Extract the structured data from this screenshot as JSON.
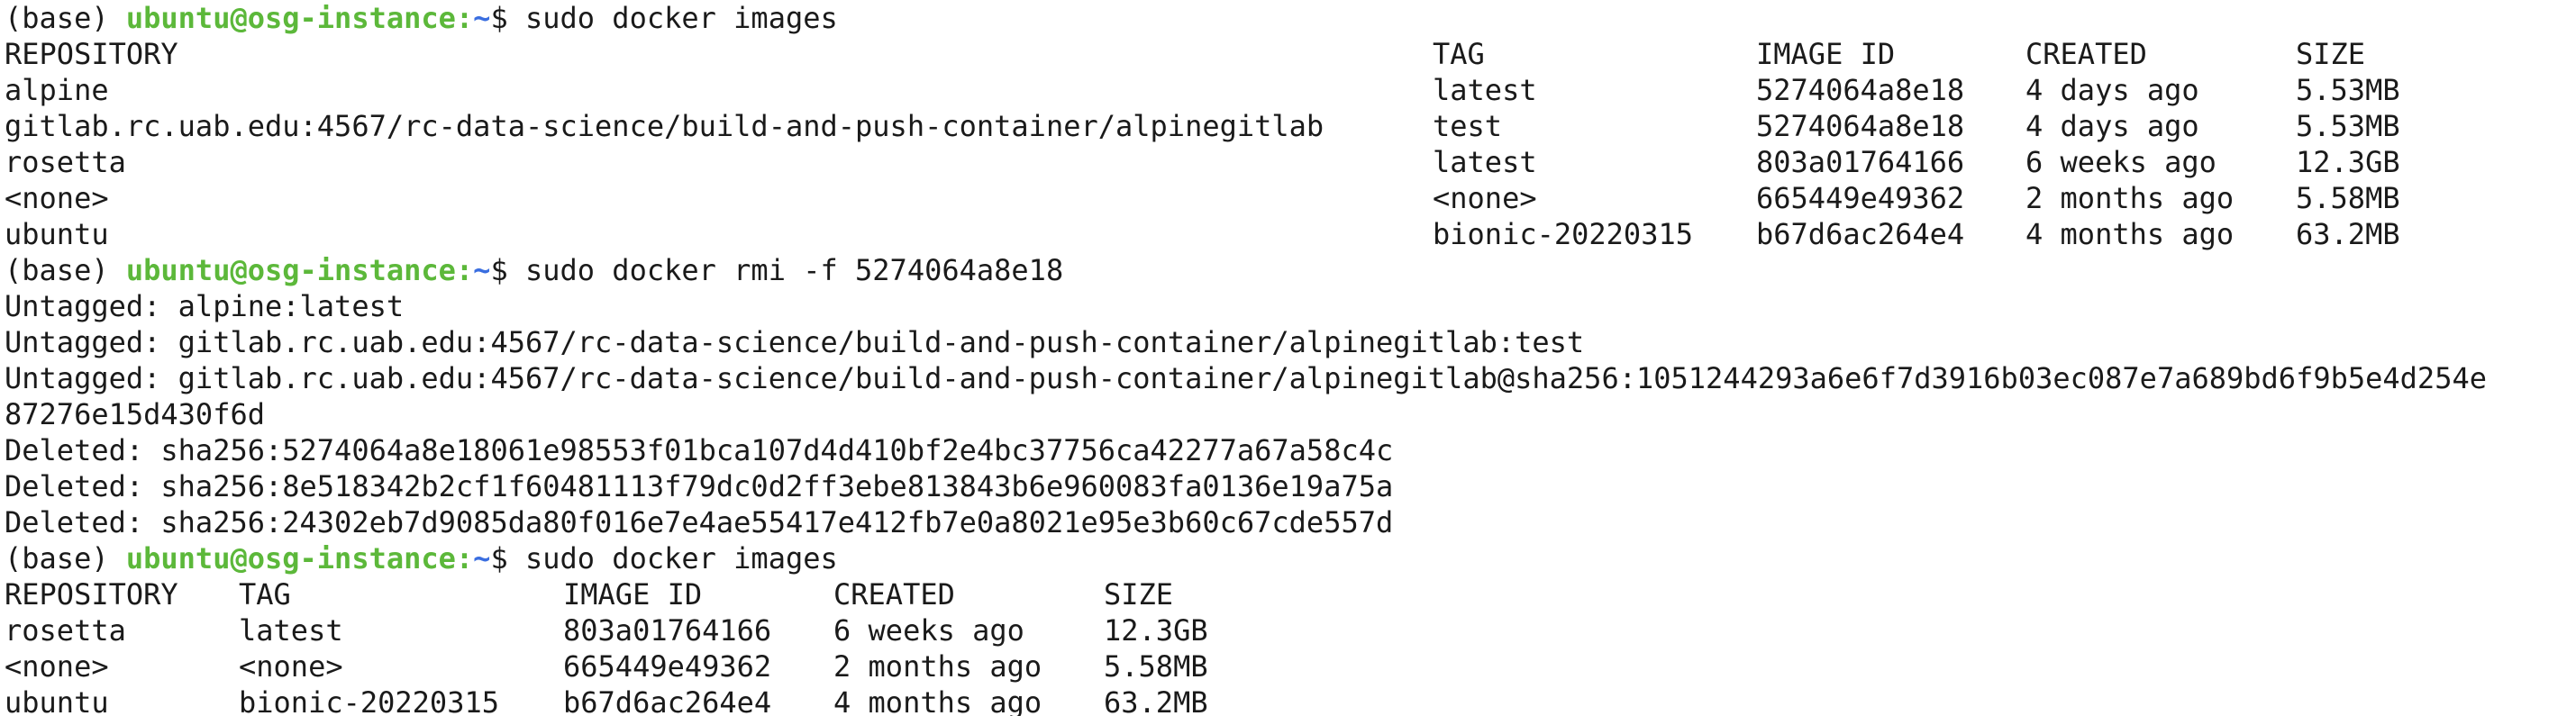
{
  "prompts": [
    {
      "prefix": "(base) ",
      "user_host": "ubuntu@osg-instance",
      "path": "~",
      "symbol": "$ ",
      "command": "sudo docker images"
    },
    {
      "prefix": "(base) ",
      "user_host": "ubuntu@osg-instance",
      "path": "~",
      "symbol": "$ ",
      "command": "sudo docker rmi -f 5274064a8e18"
    },
    {
      "prefix": "(base) ",
      "user_host": "ubuntu@osg-instance",
      "path": "~",
      "symbol": "$ ",
      "command": "sudo docker images"
    }
  ],
  "separator": ":",
  "images_before": {
    "headers": [
      "REPOSITORY",
      "TAG",
      "IMAGE ID",
      "CREATED",
      "SIZE"
    ],
    "rows": [
      [
        "alpine",
        "latest",
        "5274064a8e18",
        "4 days ago",
        "5.53MB"
      ],
      [
        "gitlab.rc.uab.edu:4567/rc-data-science/build-and-push-container/alpinegitlab",
        "test",
        "5274064a8e18",
        "4 days ago",
        "5.53MB"
      ],
      [
        "rosetta",
        "latest",
        "803a01764166",
        "6 weeks ago",
        "12.3GB"
      ],
      [
        "<none>",
        "<none>",
        "665449e49362",
        "2 months ago",
        "5.58MB"
      ],
      [
        "ubuntu",
        "bionic-20220315",
        "b67d6ac264e4",
        "4 months ago",
        "63.2MB"
      ]
    ]
  },
  "rmi_output": [
    "Untagged: alpine:latest",
    "Untagged: gitlab.rc.uab.edu:4567/rc-data-science/build-and-push-container/alpinegitlab:test",
    "Untagged: gitlab.rc.uab.edu:4567/rc-data-science/build-and-push-container/alpinegitlab@sha256:1051244293a6e6f7d3916b03ec087e7a689bd6f9b5e4d254e",
    "87276e15d430f6d",
    "Deleted: sha256:5274064a8e18061e98553f01bca107d4d410bf2e4bc37756ca42277a67a58c4c",
    "Deleted: sha256:8e518342b2cf1f60481113f79dc0d2ff3ebe813843b6e960083fa0136e19a75a",
    "Deleted: sha256:24302eb7d9085da80f016e7e4ae55417e412fb7e0a8021e95e3b60c67cde557d"
  ],
  "images_after": {
    "headers": [
      "REPOSITORY",
      "TAG",
      "IMAGE ID",
      "CREATED",
      "SIZE"
    ],
    "rows": [
      [
        "rosetta",
        "latest",
        "803a01764166",
        "6 weeks ago",
        "12.3GB"
      ],
      [
        "<none>",
        "<none>",
        "665449e49362",
        "2 months ago",
        "5.58MB"
      ],
      [
        "ubuntu",
        "bionic-20220315",
        "b67d6ac264e4",
        "4 months ago",
        "63.2MB"
      ]
    ]
  },
  "colors": {
    "user_host": "#5cb83a",
    "path": "#3a6ee0",
    "text": "#1a1a1a",
    "background": "#ffffff"
  }
}
